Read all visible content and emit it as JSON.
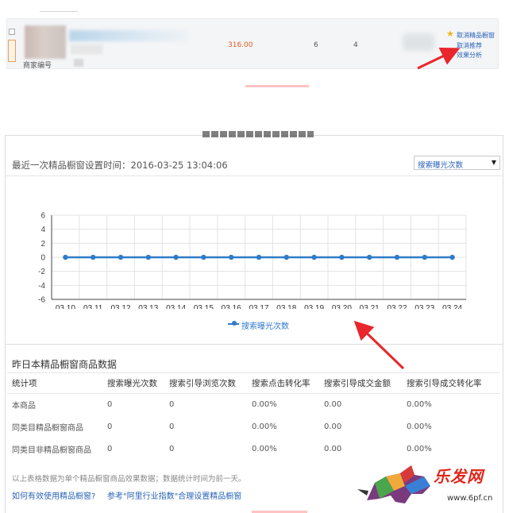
{
  "top_row": {
    "shop_label": "商家编号",
    "price": "316.00",
    "count_1": "6",
    "count_2": "4",
    "links": {
      "cancel_window": "取消精品橱窗",
      "cancel_recommend": "取消推荐",
      "effect_analysis": "效果分析"
    }
  },
  "panel": {
    "last_set_time": "最近一次精品橱窗设置时间：2016-03-25 13:04:06",
    "metric_select": {
      "selected": "搜索曝光次数"
    }
  },
  "chart_data": {
    "type": "line",
    "x": [
      "03.10",
      "03.11",
      "03.12",
      "03.13",
      "03.14",
      "03.15",
      "03.16",
      "03.17",
      "03.18",
      "03.19",
      "03.20",
      "03.21",
      "03.22",
      "03.23",
      "03.24"
    ],
    "yticks": [
      6,
      4,
      2,
      0,
      -2,
      -4,
      -6
    ],
    "ylim": [
      -6,
      6
    ],
    "grid": true,
    "legend_position": "bottom-center",
    "color": "#2f7bc8",
    "series": [
      {
        "name": "搜索曝光次数",
        "values": [
          0,
          0,
          0,
          0,
          0,
          0,
          0,
          0,
          0,
          0,
          0,
          0,
          0,
          0,
          0
        ]
      }
    ]
  },
  "stats": {
    "title": "昨日本精品橱窗商品数据",
    "headers": [
      "统计项",
      "搜索曝光次数",
      "搜索引导浏览次数",
      "搜索点击转化率",
      "搜索引导成交金额",
      "搜索引导成交转化率"
    ],
    "rows": [
      [
        "本商品",
        "0",
        "0",
        "0.00%",
        "0.00",
        "0.00%"
      ],
      [
        "同类目精品橱窗商品",
        "0",
        "0",
        "0.00%",
        "0.00",
        "0.00%"
      ],
      [
        "同类目非精品橱窗商品",
        "0",
        "0",
        "0.00%",
        "0.00",
        "0.00%"
      ]
    ],
    "footnote": "以上表格数据为单个精品橱窗商品效果数据；数据统计时间为前一天。",
    "help_link_1": "如何有效使用精品橱窗?",
    "help_link_2": "参考\"阿里行业指数\"合理设置精品橱窗"
  },
  "watermark": {
    "title": "乐发网",
    "url": "www.6pf.cn"
  }
}
